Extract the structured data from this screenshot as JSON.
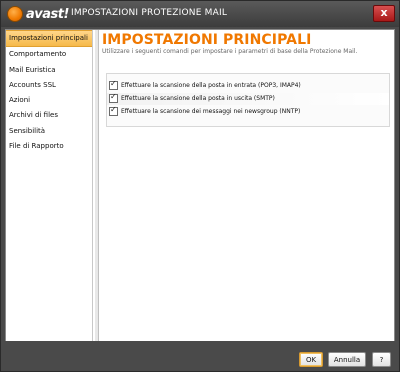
{
  "window": {
    "logo_text": "avast!",
    "title": "IMPOSTAZIONI PROTEZIONE MAIL",
    "close_glyph": "x"
  },
  "sidebar": {
    "items": [
      {
        "label": "Impostazioni principali",
        "active": true
      },
      {
        "label": "Comportamento",
        "active": false
      },
      {
        "label": "Mail Euristica",
        "active": false
      },
      {
        "label": "Accounts SSL",
        "active": false
      },
      {
        "label": "Azioni",
        "active": false
      },
      {
        "label": "Archivi di files",
        "active": false
      },
      {
        "label": "Sensibilità",
        "active": false
      },
      {
        "label": "File di Rapporto",
        "active": false
      }
    ]
  },
  "main": {
    "heading": "IMPOSTAZIONI PRINCIPALI",
    "subtext": "Utilizzare i seguenti comandi per impostare i parametri di base della Protezione Mail.",
    "options": [
      {
        "label": "Effettuare la scansione della posta in entrata (POP3, IMAP4)",
        "checked": true
      },
      {
        "label": "Effettuare la scansione della posta in uscita (SMTP)",
        "checked": true
      },
      {
        "label": "Effettuare la scansione dei messaggi nei newsgroup (NNTP)",
        "checked": true
      }
    ]
  },
  "footer": {
    "ok_label": "OK",
    "cancel_label": "Annulla",
    "help_label": "?"
  },
  "colors": {
    "accent": "#f07800",
    "active_item": "#f6b94a",
    "chrome": "#4a4a4a"
  }
}
